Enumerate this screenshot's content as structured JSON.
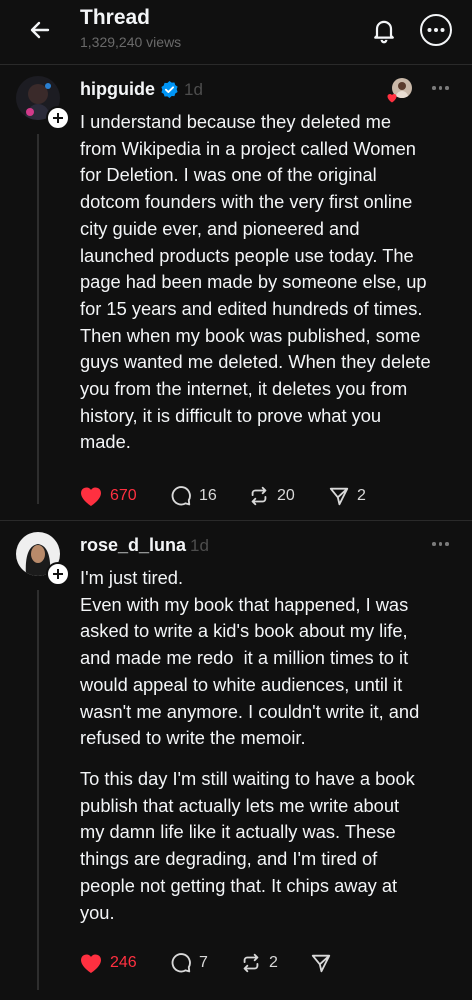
{
  "header": {
    "title": "Thread",
    "views": "1,329,240 views"
  },
  "posts": [
    {
      "username": "hipguide",
      "verified": true,
      "time": "1d",
      "text": "I understand because they deleted me\nfrom Wikipedia in a project called Women\nfor Deletion. I was one of the original\ndotcom founders with the very first online\ncity guide ever, and pioneered and\nlaunched products people use today. The\npage had been made by someone else, up\nfor 15 years and edited hundreds of times.\nThen when my book was published, some\nguys wanted me deleted. When they delete\nyou from the internet, it deletes you from\nhistory, it is difficult to prove what you\nmade.",
      "likes": "670",
      "replies": "16",
      "reposts": "20",
      "shares": "2",
      "liked": true
    },
    {
      "username": "rose_d_luna",
      "verified": false,
      "time": "1d",
      "text_p1": "I'm just tired.\nEven with my book that happened, I was\nasked to write a kid's book about my life,\nand made me redo  it a million times to it\nwould appeal to white audiences, until it\nwasn't me anymore. I couldn't write it, and\nrefused to write the memoir.",
      "text_p2": "To this day I'm still waiting to have a book\npublish that actually lets me write about\nmy damn life like it actually was. These\nthings are degrading, and I'm tired of\npeople not getting that. It chips away at\nyou.",
      "likes": "246",
      "replies": "7",
      "reposts": "2",
      "liked": true
    }
  ],
  "colors": {
    "background": "#101010",
    "like_red": "#ff3040",
    "verified_blue": "#0095f6",
    "muted": "#6a6a6a"
  },
  "icons": {
    "back": "arrow-left-icon",
    "notifications": "bell-icon",
    "more": "more-circle-icon"
  }
}
